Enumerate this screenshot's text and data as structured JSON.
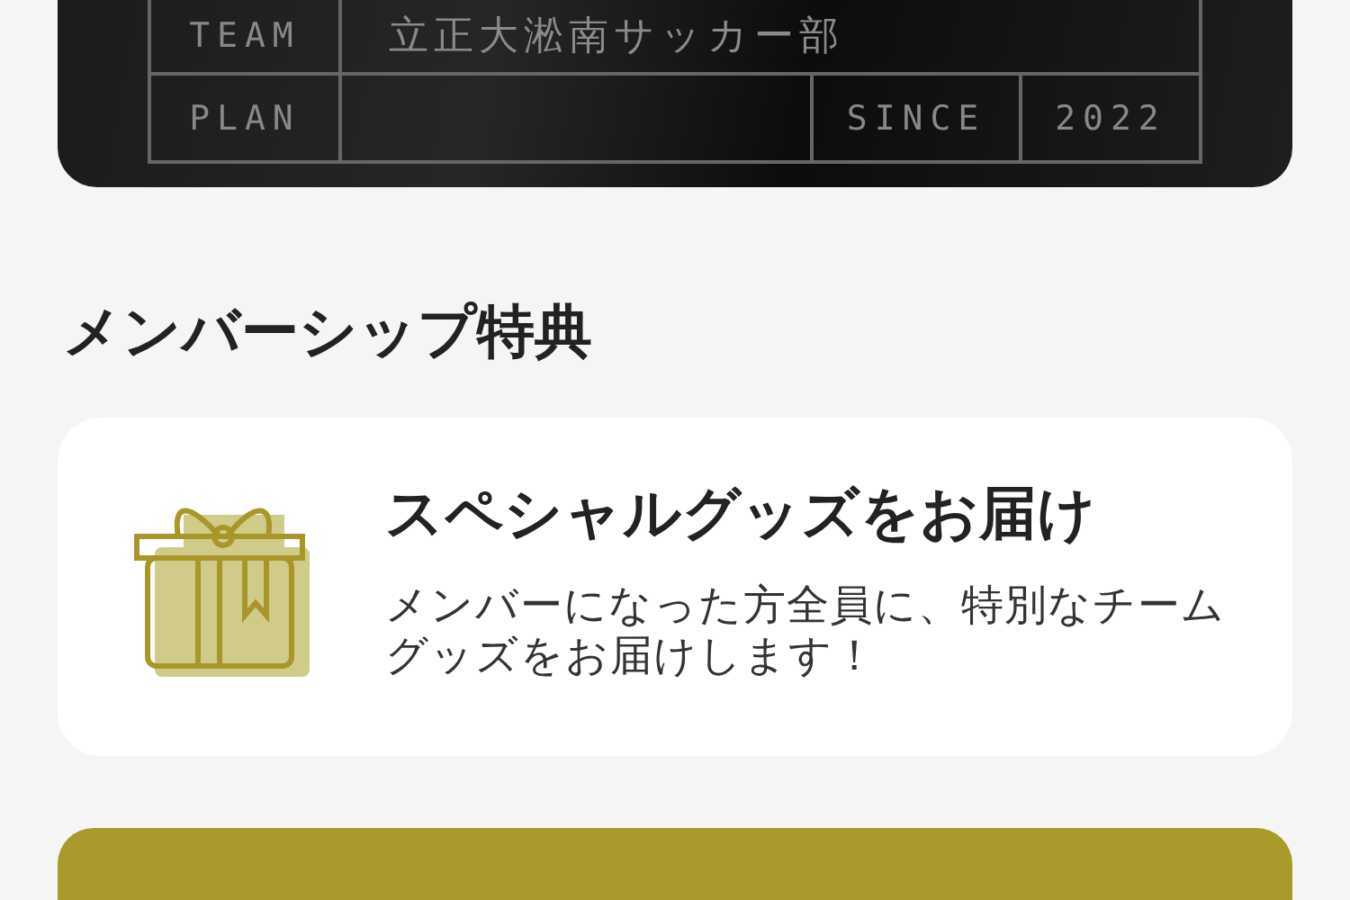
{
  "member_card": {
    "team_label": "TEAM",
    "team_name": "立正大淞南サッカー部",
    "plan_label": "PLAN",
    "since_label": "SINCE",
    "since_year": "2022"
  },
  "benefits": {
    "heading": "メンバーシップ特典",
    "items": [
      {
        "title": "スペシャルグッズをお届け",
        "description": "メンバーになった方全員に、特別なチームグッズをお届けします！"
      }
    ]
  }
}
